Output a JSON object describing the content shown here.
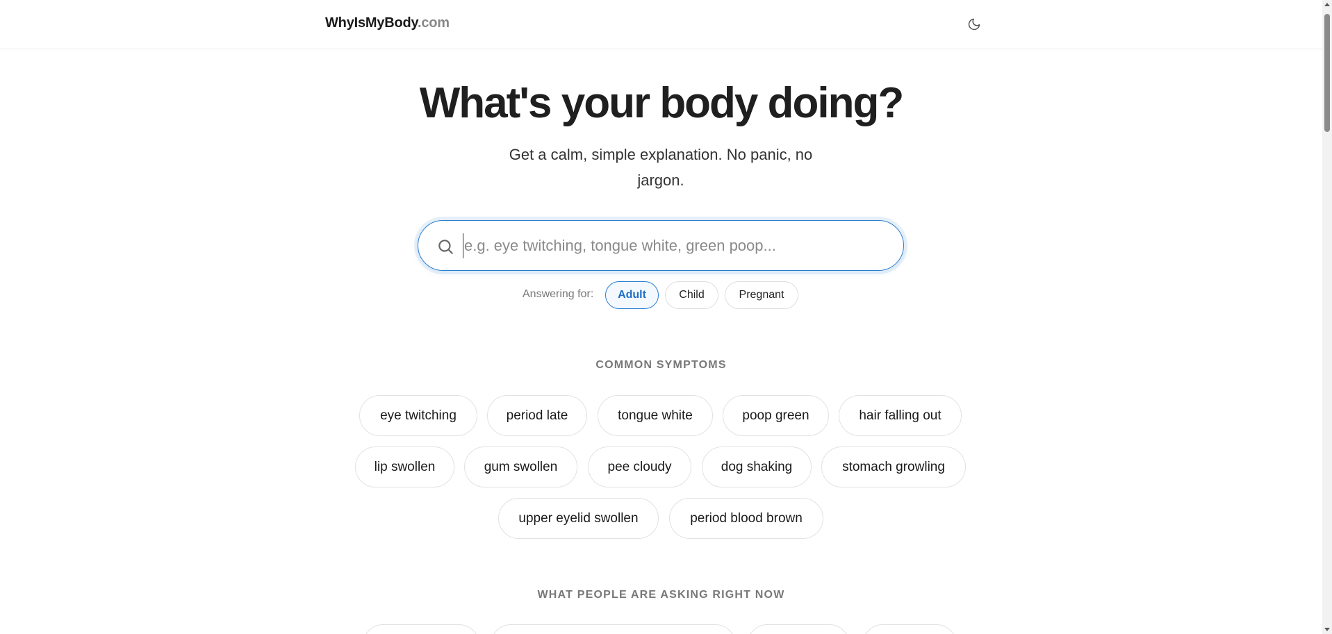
{
  "header": {
    "logo_main": "WhyIsMyBody",
    "logo_tld": ".com",
    "theme_toggle_icon": "moon-icon"
  },
  "hero": {
    "title": "What's your body doing?",
    "subtitle": "Get a calm, simple explanation. No panic, no jargon."
  },
  "search": {
    "icon": "search-icon",
    "placeholder": "e.g. eye twitching, tongue white, green poop...",
    "value": ""
  },
  "answering_for": {
    "label": "Answering for:",
    "options": [
      "Adult",
      "Child",
      "Pregnant"
    ],
    "selected": "Adult"
  },
  "common_symptoms": {
    "heading": "COMMON SYMPTOMS",
    "items": [
      "eye twitching",
      "period late",
      "tongue white",
      "poop green",
      "hair falling out",
      "lip swollen",
      "gum swollen",
      "pee cloudy",
      "dog shaking",
      "stomach growling",
      "upper eyelid swollen",
      "period blood brown"
    ]
  },
  "trending": {
    "heading": "WHAT PEOPLE ARE ASKING RIGHT NOW"
  },
  "colors": {
    "accent": "#2a7dd0",
    "text": "#1a1a1a",
    "muted": "#777777",
    "border": "#e2e2e2"
  }
}
